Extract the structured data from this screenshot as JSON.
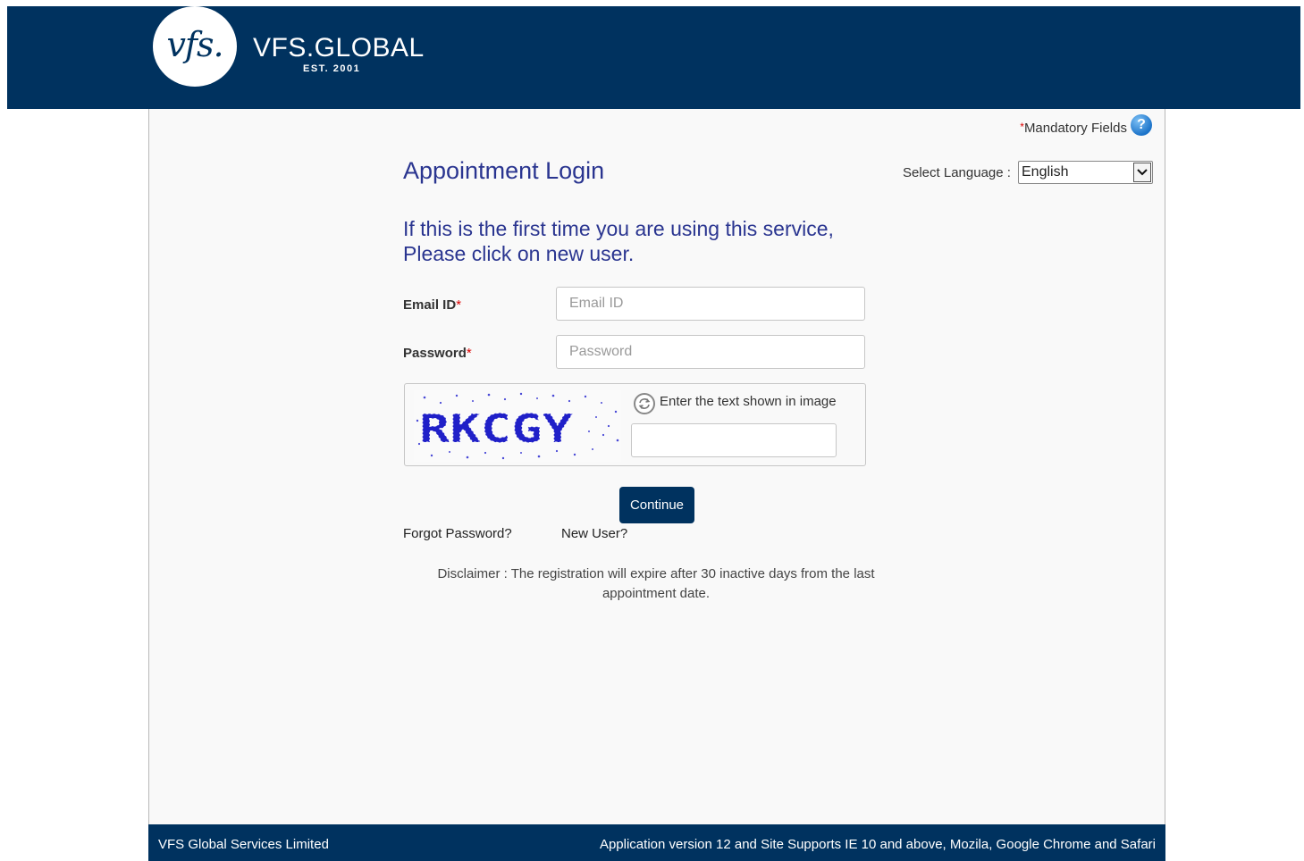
{
  "header": {
    "logo_mark": "vfs.",
    "brand_name": "VFS.GLOBAL",
    "brand_est": "EST. 2001"
  },
  "mandatory": {
    "star": "*",
    "label": "Mandatory Fields",
    "help_icon": "question-mark-icon",
    "help_glyph": "?"
  },
  "title": "Appointment Login",
  "language": {
    "label": "Select Language :",
    "selected": "English"
  },
  "intro": {
    "line1": "If this is the first time you are using this service,",
    "line2": "Please click on new user."
  },
  "email": {
    "label": "Email ID",
    "required_mark": "*",
    "placeholder": "Email ID",
    "value": ""
  },
  "password": {
    "label": "Password",
    "required_mark": "*",
    "placeholder": "Password",
    "value": ""
  },
  "captcha": {
    "image_text": "RKCGY",
    "prompt": "Enter the text shown in image",
    "value": "",
    "refresh_icon": "refresh-icon"
  },
  "continue_label": "Continue",
  "links": {
    "forgot": "Forgot Password?",
    "new_user": "New User?"
  },
  "disclaimer": "Disclaimer : The registration will expire after 30 inactive days from the last appointment date.",
  "footer": {
    "left": "VFS Global Services Limited",
    "right": "Application version 12 and Site Supports IE 10 and above, Mozila, Google Chrome and Safari"
  },
  "colors": {
    "brand_navy": "#00325f",
    "heading_blue": "#2a3590",
    "required_red": "#dd0000"
  }
}
